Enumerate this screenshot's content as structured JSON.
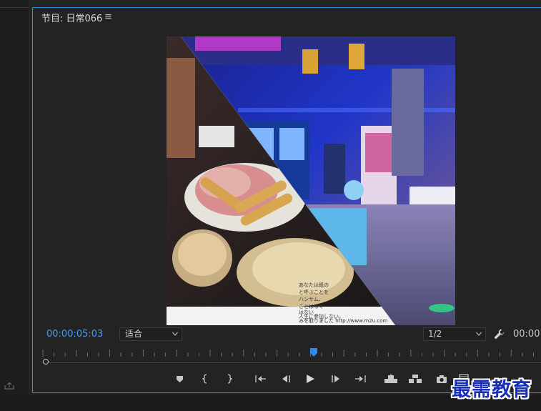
{
  "panel": {
    "title": "节目: 日常066",
    "menu_icon": "hamburger-icon"
  },
  "viewer": {
    "image_text": [
      "あなたは紙の",
      "と呼ぶことを",
      "ハンサム、",
      "ことはなく",
      "はない",
      "人生に参加しない。",
      "みを取りました http://www.m2u.com"
    ]
  },
  "controls": {
    "current_timecode": "00:00:05:03",
    "zoom_value": "适合",
    "resolution_value": "1/2",
    "duration_timecode": "00:00:",
    "wrench_icon": "wrench-icon"
  },
  "transport": {
    "buttons": [
      {
        "name": "add-marker-button",
        "icon": "marker-icon"
      },
      {
        "name": "mark-in-button",
        "icon": "mark-in-icon"
      },
      {
        "name": "mark-out-button",
        "icon": "mark-out-icon"
      },
      {
        "name": "go-to-in-button",
        "icon": "go-to-in-icon"
      },
      {
        "name": "step-back-button",
        "icon": "step-back-icon"
      },
      {
        "name": "play-button",
        "icon": "play-icon"
      },
      {
        "name": "step-forward-button",
        "icon": "step-forward-icon"
      },
      {
        "name": "go-to-out-button",
        "icon": "go-to-out-icon"
      },
      {
        "name": "lift-button",
        "icon": "lift-icon"
      },
      {
        "name": "extract-button",
        "icon": "extract-icon"
      },
      {
        "name": "export-frame-button",
        "icon": "camera-icon"
      },
      {
        "name": "comparison-view-button",
        "icon": "comparison-icon"
      }
    ]
  },
  "watermark": "最需教育",
  "colors": {
    "accent": "#2d8ceb",
    "timecode": "#4a9bf0",
    "panel_bg": "#232323"
  }
}
